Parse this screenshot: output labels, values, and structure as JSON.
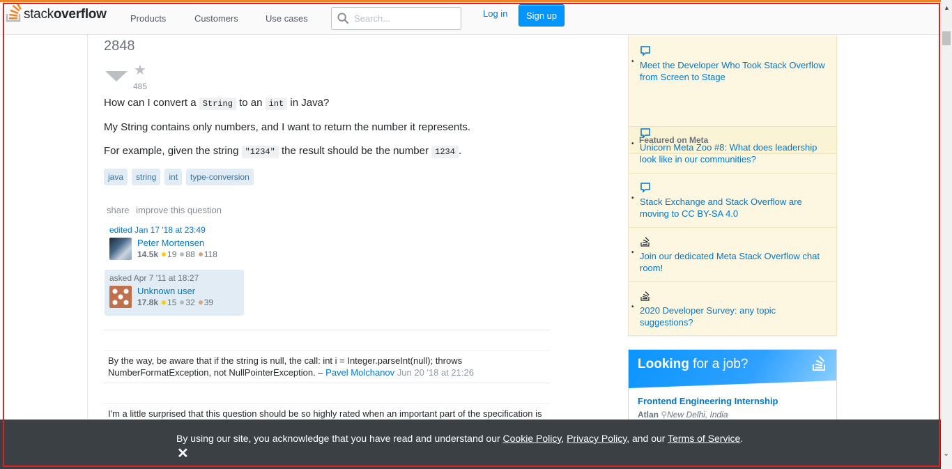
{
  "header": {
    "logo_prefix": "stack",
    "logo_bold": "overflow",
    "nav": [
      "Products",
      "Customers",
      "Use cases"
    ],
    "search_placeholder": "Search...",
    "login": "Log in",
    "signup": "Sign up"
  },
  "question": {
    "votes": "2848",
    "favorites": "485",
    "line1_a": "How can I convert a ",
    "line1_code1": "String",
    "line1_b": " to an ",
    "line1_code2": "int",
    "line1_c": " in Java?",
    "line2": "My String contains only numbers, and I want to return the number it represents.",
    "line3_a": "For example, given the string ",
    "line3_code1": "\"1234\"",
    "line3_b": " the result should be the number ",
    "line3_code2": "1234",
    "line3_c": ".",
    "tags": [
      "java",
      "string",
      "int",
      "type-conversion"
    ],
    "menu": {
      "share": "share",
      "improve": "improve this question"
    },
    "edited": {
      "action": "edited Jan 17 '18 at 23:49",
      "user": "Peter Mortensen",
      "rep": "14.5k",
      "gold": "19",
      "silver": "88",
      "bronze": "118"
    },
    "asked": {
      "action": "asked Apr 7 '11 at 18:27",
      "user": "Unknown user",
      "rep": "17.8k",
      "gold": "15",
      "silver": "32",
      "bronze": "39"
    }
  },
  "comments": [
    {
      "text_line1": "By the way, be aware that if the string is null, the call: int i = Integer.parseInt(null); throws",
      "text_line2": "NumberFormatException, not NullPointerException. – ",
      "user": "Pavel Molchanov",
      "date": "Jun 20 '18 at 21:26"
    },
    {
      "text_line1": "I'm a little surprised that this question should be so highly rated when an important part of the specification is"
    }
  ],
  "sidebar": {
    "items_top": [
      {
        "title": "Meet the Developer Who Took Stack Overflow from Screen to Stage"
      }
    ],
    "meta_header": "Featured on Meta",
    "items_meta": [
      {
        "title": "Unicorn Meta Zoo #8: What does leadership look like in our communities?"
      },
      {
        "title": "Stack Exchange and Stack Overflow are moving to CC BY-SA 4.0"
      },
      {
        "title": "Join our dedicated Meta Stack Overflow chat room!"
      },
      {
        "title": "2020 Developer Survey: any topic suggestions?"
      }
    ]
  },
  "jobs": {
    "title_bold": "Looking",
    "title_rest": " for a job?",
    "job_title": "Frontend Engineering Internship",
    "company": "Atlan",
    "location": "New Delhi, India"
  },
  "cookie": {
    "text_a": "By using our site, you acknowledge that you have read and understand our ",
    "link1": "Cookie Policy",
    "sep1": ", ",
    "link2": "Privacy Policy",
    "text_b": ", and our ",
    "link3": "Terms of Service",
    "text_c": ".",
    "close": "✕"
  },
  "colors": {
    "brand_orange": "#f48024",
    "link_blue": "#0077cc",
    "signup_blue": "#0095ff",
    "sidebar_yellow": "#fdf7e2",
    "cookie_bg": "#3b4045",
    "frame_red": "#e02020"
  }
}
